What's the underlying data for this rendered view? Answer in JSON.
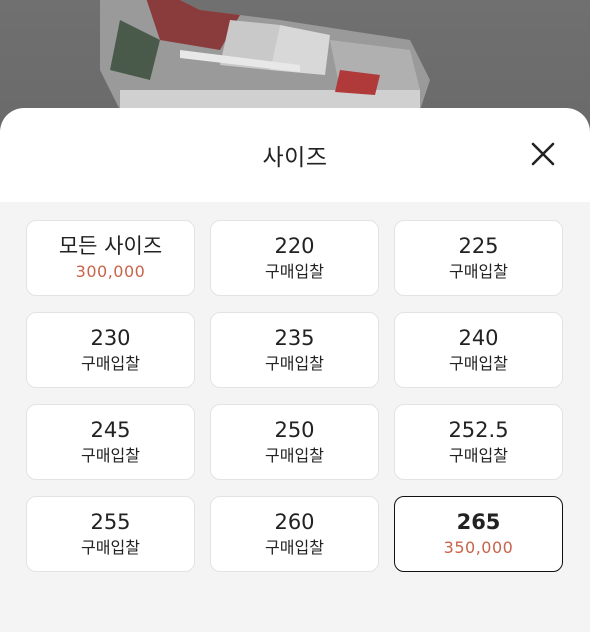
{
  "sheet": {
    "title": "사이즈",
    "close_icon": "close-icon"
  },
  "sizes": [
    {
      "size": "모든 사이즈",
      "sub": "300,000",
      "sub_type": "price",
      "selected": false
    },
    {
      "size": "220",
      "sub": "구매입찰",
      "sub_type": "label",
      "selected": false
    },
    {
      "size": "225",
      "sub": "구매입찰",
      "sub_type": "label",
      "selected": false
    },
    {
      "size": "230",
      "sub": "구매입찰",
      "sub_type": "label",
      "selected": false
    },
    {
      "size": "235",
      "sub": "구매입찰",
      "sub_type": "label",
      "selected": false
    },
    {
      "size": "240",
      "sub": "구매입찰",
      "sub_type": "label",
      "selected": false
    },
    {
      "size": "245",
      "sub": "구매입찰",
      "sub_type": "label",
      "selected": false
    },
    {
      "size": "250",
      "sub": "구매입찰",
      "sub_type": "label",
      "selected": false
    },
    {
      "size": "252.5",
      "sub": "구매입찰",
      "sub_type": "label",
      "selected": false
    },
    {
      "size": "255",
      "sub": "구매입찰",
      "sub_type": "label",
      "selected": false
    },
    {
      "size": "260",
      "sub": "구매입찰",
      "sub_type": "label",
      "selected": false
    },
    {
      "size": "265",
      "sub": "350,000",
      "sub_type": "price",
      "selected": true
    }
  ],
  "colors": {
    "price": "#c8634a",
    "selected_border": "#111111",
    "grid_background": "#f4f4f4"
  }
}
